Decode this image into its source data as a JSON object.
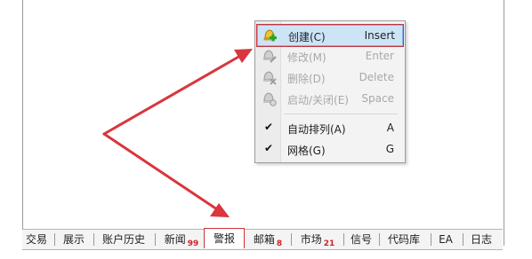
{
  "context_menu": {
    "items": [
      {
        "label": "创建(C)",
        "shortcut": "Insert",
        "icon": "bell-plus-icon",
        "enabled": true,
        "highlighted": true
      },
      {
        "label": "修改(M)",
        "shortcut": "Enter",
        "icon": "bell-edit-icon",
        "enabled": false
      },
      {
        "label": "删除(D)",
        "shortcut": "Delete",
        "icon": "bell-delete-icon",
        "enabled": false
      },
      {
        "label": "启动/关闭(E)",
        "shortcut": "Space",
        "icon": "bell-toggle-icon",
        "enabled": false
      },
      {
        "label": "自动排列(A)",
        "shortcut": "A",
        "checked": true
      },
      {
        "label": "网格(G)",
        "shortcut": "G",
        "checked": true
      }
    ]
  },
  "tabs": [
    {
      "label": "交易"
    },
    {
      "label": "展示"
    },
    {
      "label": "账户历史"
    },
    {
      "label": "新闻",
      "badge": "99"
    },
    {
      "label": "警报",
      "active": true
    },
    {
      "label": "邮箱",
      "badge": "8"
    },
    {
      "label": "市场",
      "badge": "21"
    },
    {
      "label": "信号"
    },
    {
      "label": "代码库"
    },
    {
      "label": "EA"
    },
    {
      "label": "日志"
    }
  ],
  "colors": {
    "annotation": "#d9363e",
    "highlight": "#cde4f7",
    "badge": "#d0202a"
  }
}
